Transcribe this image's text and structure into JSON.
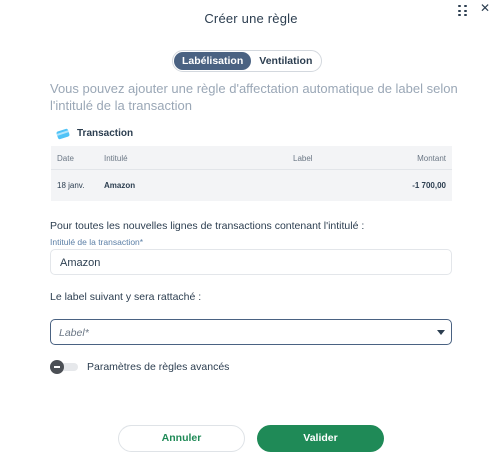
{
  "dialog": {
    "title": "Créer une règle",
    "close_icon": "close-icon",
    "grid_icon": "drag-grid-icon"
  },
  "mode_toggle": {
    "options": [
      "Labélisation",
      "Ventilation"
    ],
    "selected": "Labélisation"
  },
  "description": "Vous pouvez ajouter une règle d'affectation automatique de label selon l'intitulé de la transaction",
  "transaction": {
    "title": "Transaction",
    "icon": "credit-card-icon",
    "columns": [
      "Date",
      "Intitulé",
      "Label",
      "Montant"
    ],
    "row": {
      "date": "18 janv.",
      "intitule": "Amazon",
      "label": "",
      "montant": "-1 700,00"
    }
  },
  "form": {
    "prompt_intitule": "Pour toutes les nouvelles lignes de transactions contenant l'intitulé :",
    "intitule_label": "Intitulé de la transaction*",
    "intitule_value": "Amazon",
    "prompt_label": "Le label suivant y sera rattaché :",
    "label_placeholder": "Label*",
    "advanced_label": "Paramètres de règles avancés",
    "advanced_enabled": false
  },
  "actions": {
    "cancel": "Annuler",
    "confirm": "Valider"
  },
  "colors": {
    "accent_green": "#1f8a57",
    "toggle_active": "#4a6282",
    "muted_text": "#9aa7b6"
  }
}
